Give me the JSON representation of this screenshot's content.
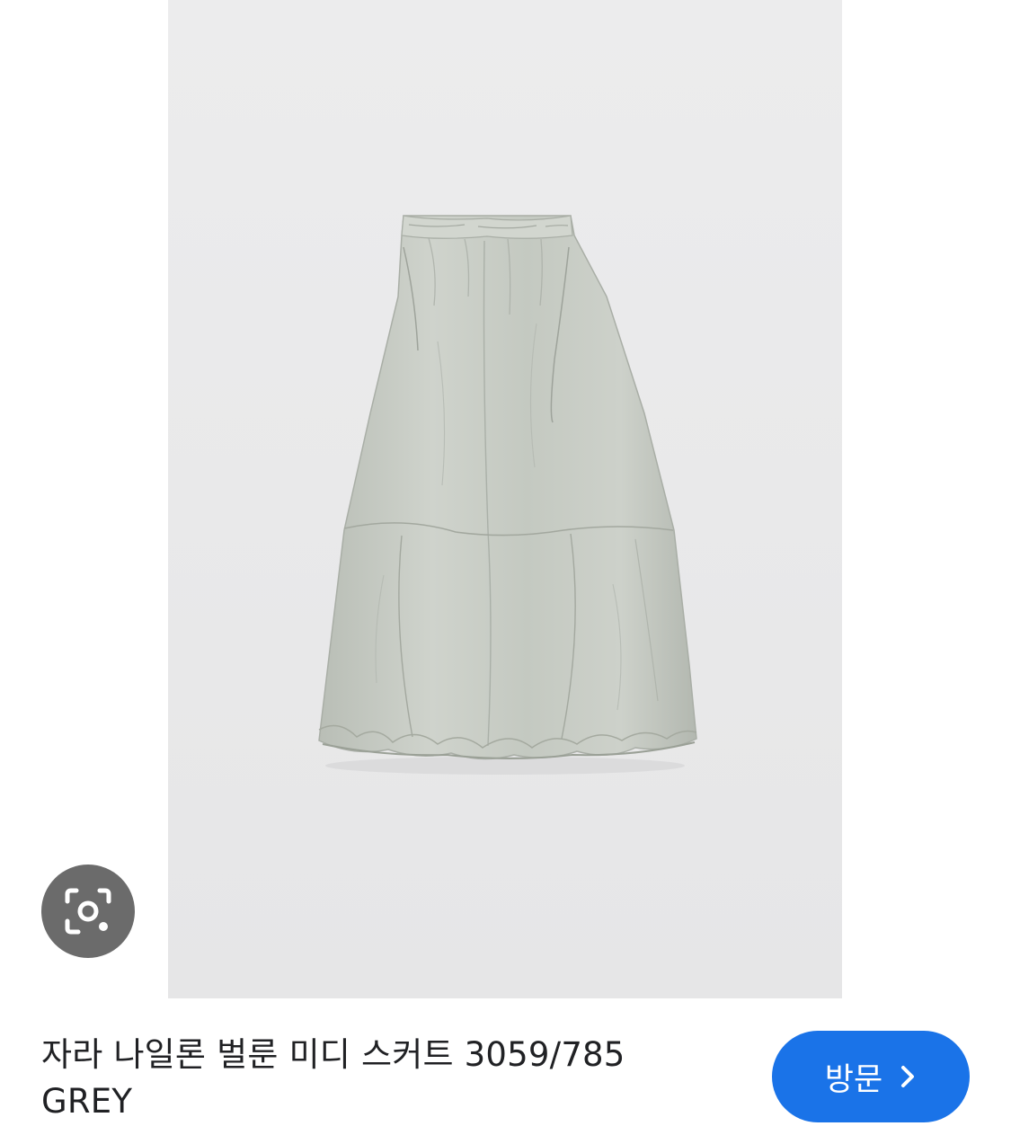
{
  "product_image": {
    "subject": "skirt-image",
    "background_color": "#e9e9ea",
    "fabric_color": "#c6cbc3"
  },
  "lens": {
    "icon": "google-lens-icon"
  },
  "result": {
    "title": "자라 나일론 벌룬 미디 스커트 3059/785 GREY"
  },
  "visit": {
    "label": "방문",
    "icon": "chevron-right-icon",
    "color": "#1a73e8"
  }
}
